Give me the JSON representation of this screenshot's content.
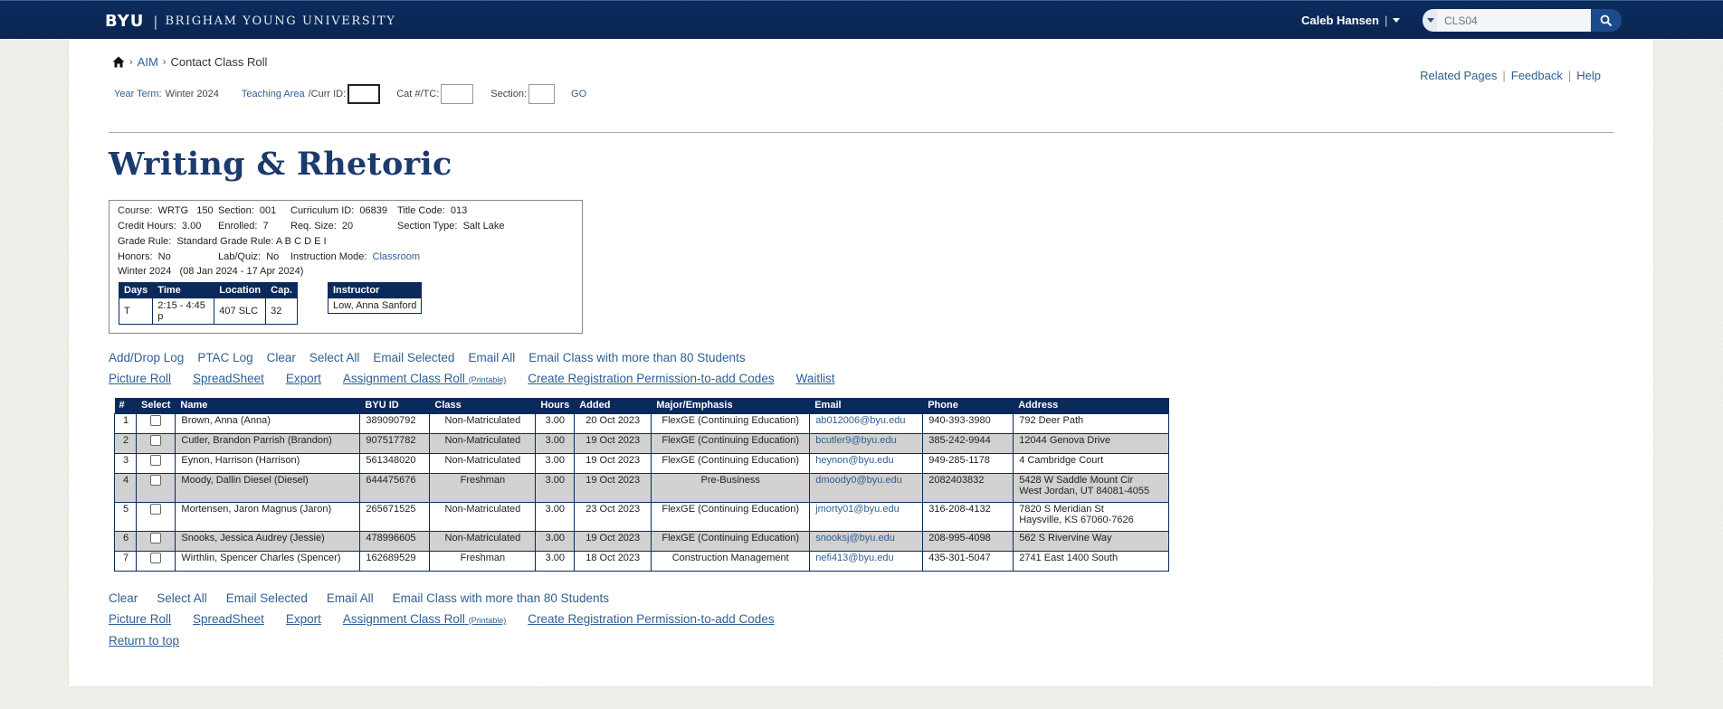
{
  "header": {
    "logo": "BYU",
    "separator": "|",
    "university": "BRIGHAM YOUNG UNIVERSITY",
    "user": "Caleb Hansen",
    "user_separator": "|",
    "search_placeholder": "CLS04"
  },
  "breadcrumb": {
    "items": [
      "AIM",
      "Contact Class Roll"
    ],
    "separator": "›"
  },
  "filters": {
    "year_term_label": "Year Term:",
    "year_term_value": "Winter 2024",
    "teaching_area_label": "Teaching Area",
    "curr_id_label": "/Curr ID:",
    "cat_tc_label": "Cat #/TC:",
    "section_label": "Section:",
    "go": "GO"
  },
  "top_links": {
    "related": "Related Pages",
    "sep": "|",
    "feedback": "Feedback",
    "help": "Help"
  },
  "page_title": "Writing & Rhetoric",
  "course_info": {
    "course_label": "Course:",
    "course": "WRTG   150",
    "section_label": "Section:",
    "section": "001",
    "curriculum_label": "Curriculum ID:",
    "curriculum": "06839",
    "title_code_label": "Title Code:",
    "title_code": "013",
    "credit_label": "Credit Hours:",
    "credit": "3.00",
    "enrolled_label": "Enrolled:",
    "enrolled": "7",
    "req_label": "Req. Size:",
    "req": "20",
    "section_type_label": "Section Type:",
    "section_type": "Salt Lake",
    "grade_rule_label": "Grade Rule:",
    "grade_rule": "Standard Grade Rule: A B C D E I",
    "honors_label": "Honors:",
    "honors": "No",
    "lab_label": "Lab/Quiz:",
    "lab": "No",
    "instruction_label": "Instruction Mode:",
    "instruction": "Classroom",
    "term": "Winter 2024   (08 Jan 2024 - 17 Apr 2024)"
  },
  "schedule": {
    "headers": [
      "Days",
      "Time",
      "Location",
      "Cap."
    ],
    "row": [
      "T",
      "2:15 - 4:45 p",
      "407 SLC",
      "32"
    ]
  },
  "instructor": {
    "header": "Instructor",
    "name": "Low, Anna Sanford"
  },
  "actions_top_1": [
    "Add/Drop Log",
    "PTAC Log",
    "Clear",
    "Select All",
    "Email Selected",
    "Email All",
    "Email Class with more than 80 Students"
  ],
  "actions_top_2": {
    "picture_roll": "Picture Roll",
    "spreadsheet": "SpreadSheet",
    "export": "Export",
    "assignment": "Assignment Class Roll",
    "printable": "(Printable)",
    "create_codes": "Create Registration Permission-to-add Codes",
    "waitlist": "Waitlist"
  },
  "roster": {
    "headers": [
      "#",
      "Select",
      "Name",
      "BYU ID",
      "Class",
      "Hours",
      "Added",
      "Major/Emphasis",
      "Email",
      "Phone",
      "Address"
    ],
    "rows": [
      {
        "n": "1",
        "name": "Brown, Anna (Anna)",
        "id": "389090792",
        "cls": "Non-Matriculated",
        "hours": "3.00",
        "added": "20 Oct 2023",
        "major": "FlexGE (Continuing Education)",
        "email": "ab012006@byu.edu",
        "phone": "940-393-3980",
        "addr1": "792 Deer Path",
        "addr2": ""
      },
      {
        "n": "2",
        "name": "Cutler, Brandon Parrish (Brandon)",
        "id": "907517782",
        "cls": "Non-Matriculated",
        "hours": "3.00",
        "added": "19 Oct 2023",
        "major": "FlexGE (Continuing Education)",
        "email": "bcutler9@byu.edu",
        "phone": "385-242-9944",
        "addr1": "12044 Genova Drive",
        "addr2": ""
      },
      {
        "n": "3",
        "name": "Eynon, Harrison (Harrison)",
        "id": "561348020",
        "cls": "Non-Matriculated",
        "hours": "3.00",
        "added": "19 Oct 2023",
        "major": "FlexGE (Continuing Education)",
        "email": "heynon@byu.edu",
        "phone": "949-285-1178",
        "addr1": "4 Cambridge Court",
        "addr2": ""
      },
      {
        "n": "4",
        "name": "Moody, Dallin Diesel (Diesel)",
        "id": "644475676",
        "cls": "Freshman",
        "hours": "3.00",
        "added": "19 Oct 2023",
        "major": "Pre-Business",
        "email": "dmoody0@byu.edu",
        "phone": "2082403832",
        "addr1": "5428 W Saddle Mount Cir",
        "addr2": "West Jordan, UT 84081-4055"
      },
      {
        "n": "5",
        "name": "Mortensen, Jaron Magnus (Jaron)",
        "id": "265671525",
        "cls": "Non-Matriculated",
        "hours": "3.00",
        "added": "23 Oct 2023",
        "major": "FlexGE (Continuing Education)",
        "email": "jmorty01@byu.edu",
        "phone": "316-208-4132",
        "addr1": "7820 S Meridian St",
        "addr2": "Haysville, KS 67060-7626"
      },
      {
        "n": "6",
        "name": "Snooks, Jessica Audrey (Jessie)",
        "id": "478996605",
        "cls": "Non-Matriculated",
        "hours": "3.00",
        "added": "19 Oct 2023",
        "major": "FlexGE (Continuing Education)",
        "email": "snooksj@byu.edu",
        "phone": "208-995-4098",
        "addr1": "562 S Rivervine Way",
        "addr2": ""
      },
      {
        "n": "7",
        "name": "Wirthlin, Spencer Charles (Spencer)",
        "id": "162689529",
        "cls": "Freshman",
        "hours": "3.00",
        "added": "18 Oct 2023",
        "major": "Construction Management",
        "email": "nefi413@byu.edu",
        "phone": "435-301-5047",
        "addr1": "2741 East 1400 South",
        "addr2": ""
      }
    ]
  },
  "actions_bottom_1": [
    "Clear",
    "Select All",
    "Email Selected",
    "Email All",
    "Email Class with more than 80 Students"
  ],
  "actions_bottom_2": {
    "picture_roll": "Picture Roll",
    "spreadsheet": "SpreadSheet",
    "export": "Export",
    "assignment": "Assignment Class Roll",
    "printable": "(Printable)",
    "create_codes": "Create Registration Permission-to-add Codes"
  },
  "return_top": "Return to top",
  "colors": {
    "navy": "#0b2a5c",
    "link": "#2f5f94",
    "title": "#1b3a6e",
    "alt_row": "#d1d1d1"
  }
}
